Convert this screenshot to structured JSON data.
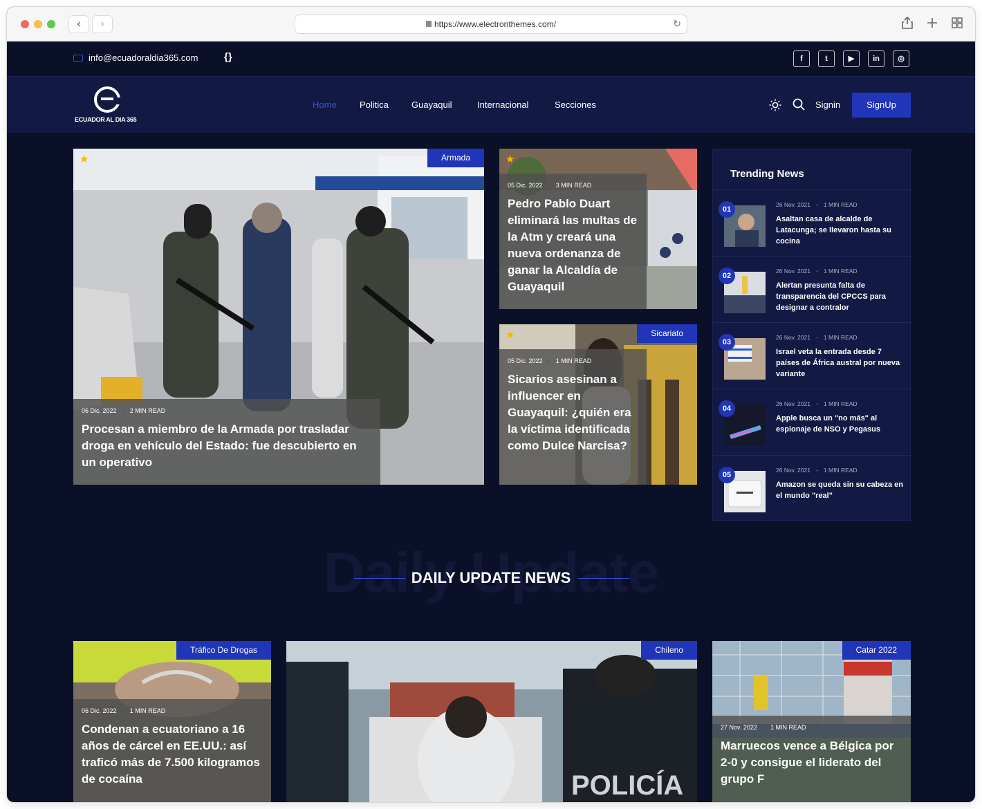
{
  "browser": {
    "url": "https://www.electronthemes.com/"
  },
  "topbar": {
    "email": "info@ecuadoraldia365.com",
    "code_icon_text": "{}",
    "social": [
      "f",
      "t",
      "▶",
      "in",
      "◎"
    ]
  },
  "header": {
    "logo_text": "ECUADOR AL DIA 365",
    "nav": [
      "Home",
      "Politica",
      "Guayaquil",
      "Internacional",
      "Secciones"
    ],
    "signin": "Signin",
    "signup": "SignUp"
  },
  "hero": {
    "main": {
      "category": "Armada",
      "date": "06 Dic. 2022",
      "read": "2 MIN READ",
      "title": "Procesan a miembro de la Armada por trasladar droga en vehículo del Estado: fue descubierto en un operativo"
    },
    "top_right": {
      "date": "05 Dic. 2022",
      "read": "3 MIN READ",
      "title": "Pedro Pablo Duart eliminará las multas de la Atm y creará una nueva ordenanza de ganar la Alcaldía de Guayaquil"
    },
    "bottom_right": {
      "category": "Sicariato",
      "date": "05 Dic. 2022",
      "read": "1 MIN READ",
      "title": "Sicarios asesinan a influencer en Guayaquil: ¿quién era la víctima identificada como Dulce Narcisa?"
    }
  },
  "trending": {
    "title": "Trending News",
    "items": [
      {
        "num": "01",
        "date": "26 Nov. 2021",
        "read": "1 MIN READ",
        "title": "Asaltan casa de alcalde de Latacunga; se llevaron hasta su cocina"
      },
      {
        "num": "02",
        "date": "26 Nov. 2021",
        "read": "1 MIN READ",
        "title": "Alertan presunta falta de transparencia del CPCCS para designar a contralor"
      },
      {
        "num": "03",
        "date": "26 Nov. 2021",
        "read": "1 MIN READ",
        "title": "Israel veta la entrada desde 7 países de África austral por nueva variante"
      },
      {
        "num": "04",
        "date": "26 Nov. 2021",
        "read": "1 MIN READ",
        "title": "Apple busca un \"no más\" al espionaje de NSO y Pegasus"
      },
      {
        "num": "05",
        "date": "26 Nov. 2021",
        "read": "1 MIN READ",
        "title": "Amazon se queda sin su cabeza en el mundo \"real\""
      }
    ]
  },
  "daily": {
    "bg_text": "Daily Update",
    "title": "DAILY UPDATE NEWS",
    "cards": [
      {
        "category": "Tráfico De Drogas",
        "date": "06 Dic. 2022",
        "read": "1 MIN READ",
        "title": "Condenan a ecuatoriano a 16 años de cárcel en EE.UU.: así traficó más de 7.500 kilogramos de cocaína"
      },
      {
        "category": "Chileno",
        "police_text": "POLICÍA"
      },
      {
        "category": "Catar 2022",
        "date": "27 Nov. 2022",
        "read": "1 MIN READ",
        "title": "Marruecos vence a Bélgica por 2-0 y consigue el liderato del grupo F"
      }
    ]
  },
  "colors": {
    "background": "#0b1029",
    "panel": "#121a44",
    "accent": "#2135b8",
    "star": "#f5b800"
  }
}
